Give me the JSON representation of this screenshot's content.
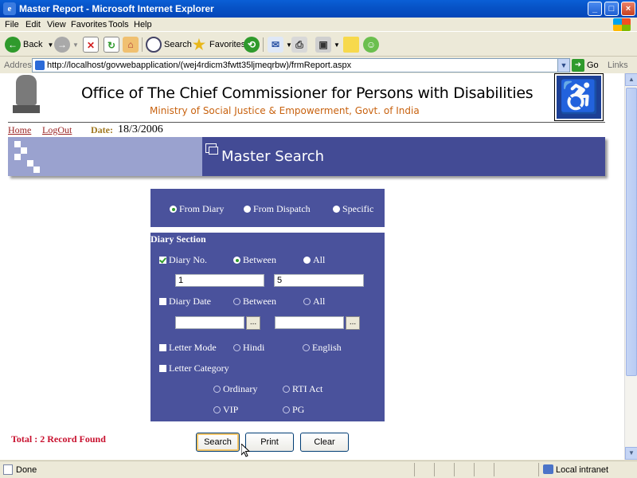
{
  "window": {
    "title": "Master Report - Microsoft Internet Explorer"
  },
  "menu": [
    "File",
    "Edit",
    "View",
    "Favorites",
    "Tools",
    "Help"
  ],
  "toolbar": {
    "back": "Back",
    "search": "Search",
    "favorites": "Favorites"
  },
  "address": {
    "label": "Address",
    "url": "http://localhost/govwebapplication/(wej4rdicm3fwtt35ljmeqrbw)/frmReport.aspx",
    "go": "Go",
    "links": "Links"
  },
  "header": {
    "title": "Office of The Chief Commissioner for Persons with Disabilities",
    "subtitle": "Ministry of Social Justice & Empowerment, Govt. of India"
  },
  "nav": {
    "home": "Home",
    "logout": "LogOut",
    "date_label": "Date:",
    "date": "18/3/2006"
  },
  "banner": {
    "title": "Master Search"
  },
  "source": {
    "from_diary": "From Diary",
    "from_dispatch": "From Dispatch",
    "specific": "Specific"
  },
  "diary": {
    "section_title": "Diary Section",
    "diary_no": "Diary No.",
    "between": "Between",
    "all": "All",
    "from_value": "1",
    "to_value": "5",
    "diary_date": "Diary Date",
    "picker": "...",
    "letter_mode": "Letter Mode",
    "hindi": "Hindi",
    "english": "English",
    "letter_category": "Letter Category",
    "ordinary": "Ordinary",
    "rti_act": "RTI Act",
    "vip": "VIP",
    "pg": "PG"
  },
  "result": {
    "total": "Total : 2 Record Found"
  },
  "buttons": {
    "search": "Search",
    "print": "Print",
    "clear": "Clear"
  },
  "status": {
    "done": "Done",
    "zone": "Local intranet"
  }
}
